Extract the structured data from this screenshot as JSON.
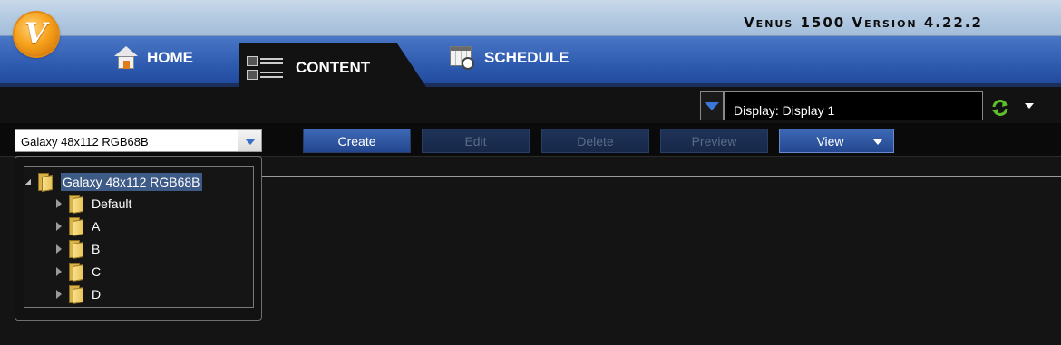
{
  "app": {
    "title": "Venus 1500 Version 4.22.2",
    "logo_letter": "V"
  },
  "nav": {
    "tabs": [
      {
        "label": "HOME",
        "icon": "home-icon",
        "active": false
      },
      {
        "label": "CONTENT",
        "icon": "content-icon",
        "active": true
      },
      {
        "label": "SCHEDULE",
        "icon": "schedule-icon",
        "active": false
      }
    ]
  },
  "display": {
    "value": "Display: Display 1"
  },
  "toolbar": {
    "sign_selector": "Galaxy 48x112 RGB68B",
    "buttons": [
      {
        "label": "Create",
        "enabled": true
      },
      {
        "label": "Edit",
        "enabled": false
      },
      {
        "label": "Delete",
        "enabled": false
      },
      {
        "label": "Preview",
        "enabled": false
      },
      {
        "label": "View",
        "enabled": true
      }
    ]
  },
  "tree": {
    "root": "Galaxy 48x112 RGB68B",
    "children": [
      "Default",
      "A",
      "B",
      "C",
      "D"
    ]
  },
  "colors": {
    "nav_blue": "#2f5cb0",
    "selection": "#3e5a86",
    "accent_orange": "#f7a21b"
  }
}
